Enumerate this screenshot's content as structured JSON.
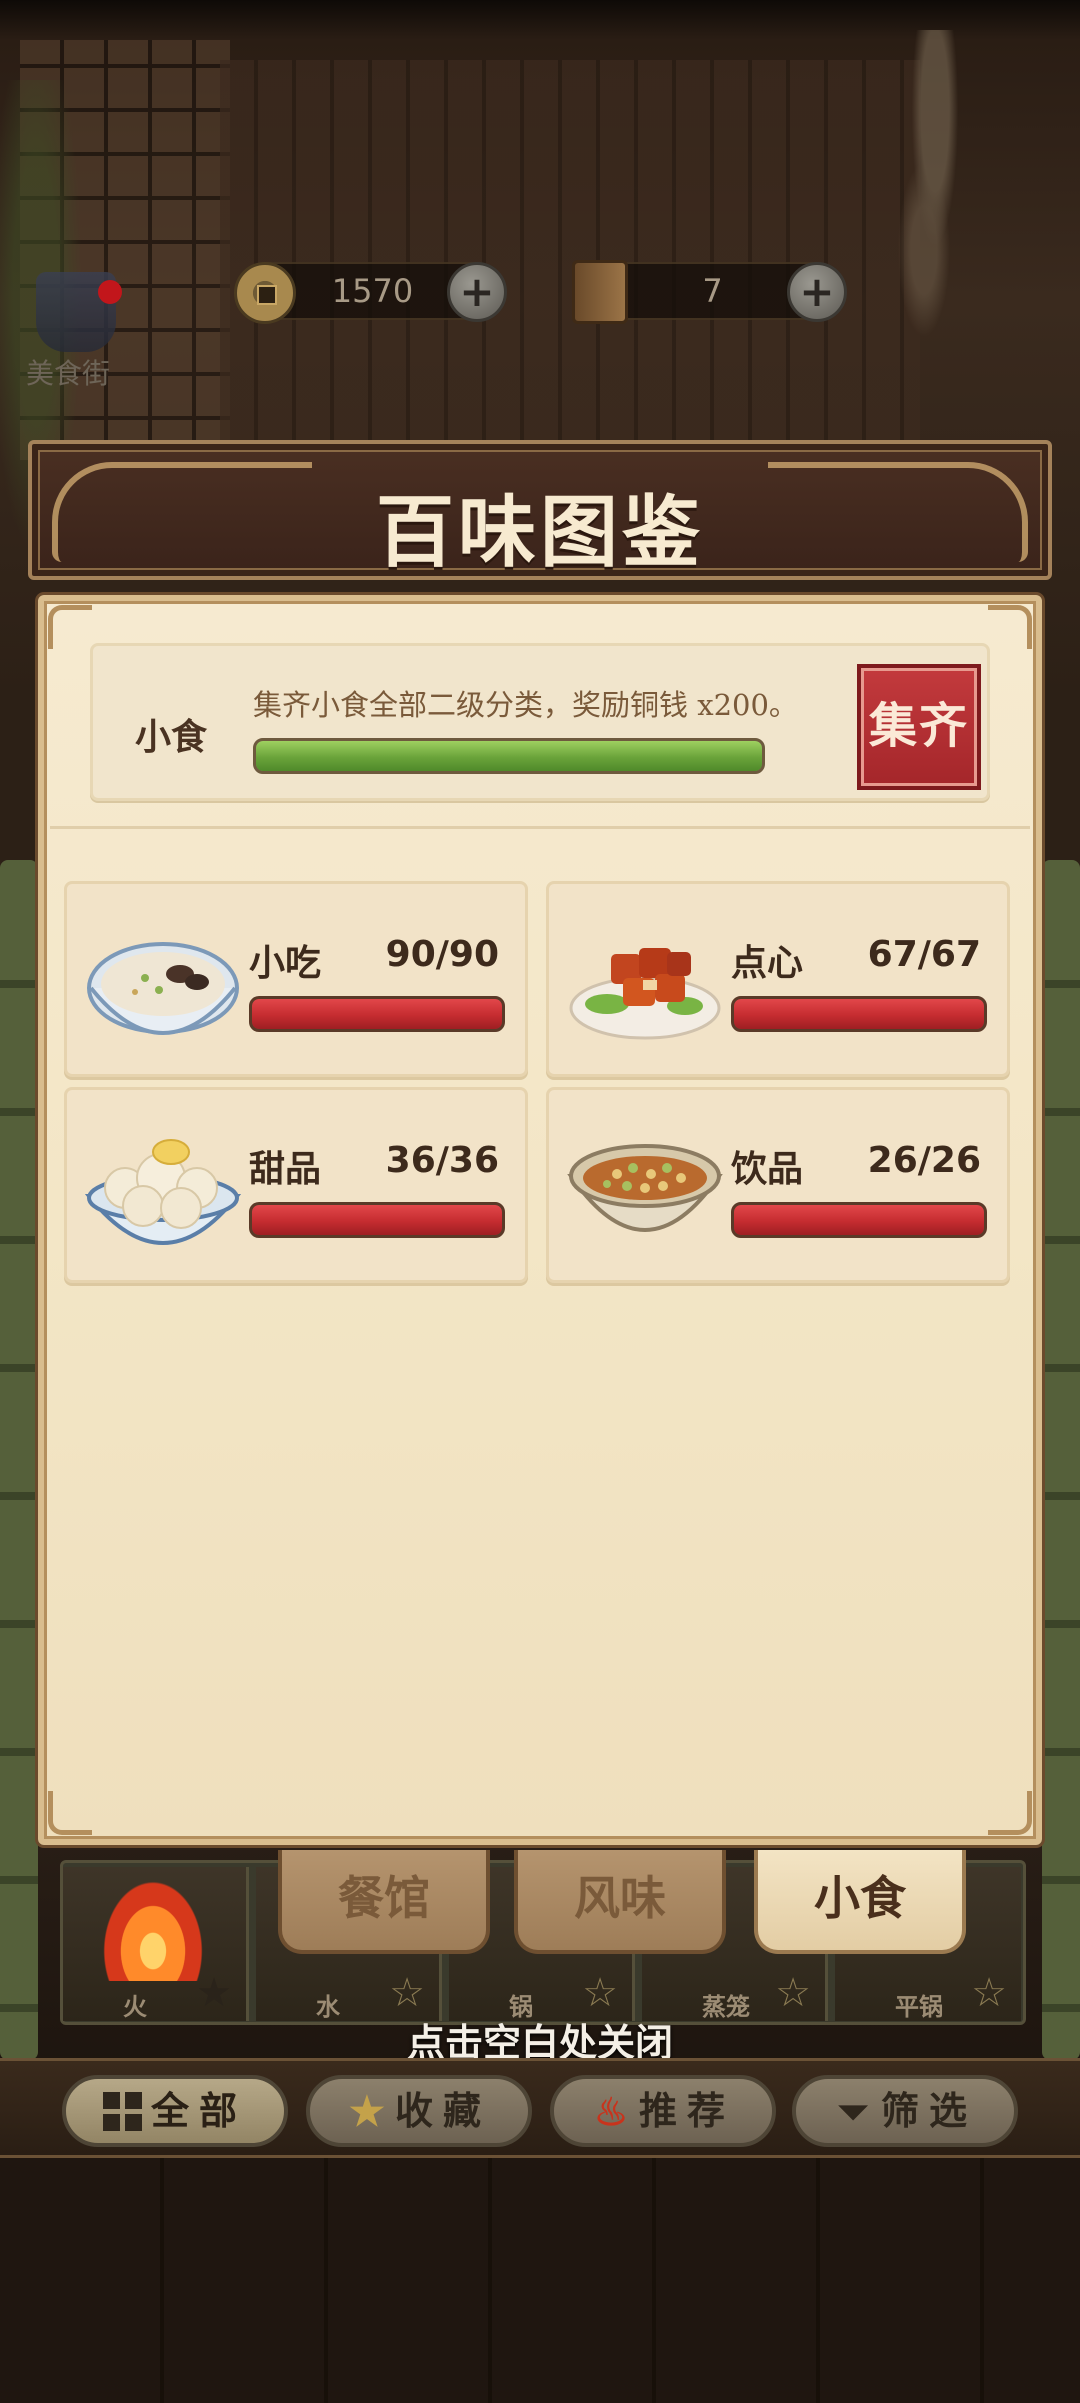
{
  "top_bar": {
    "street_label": "美食街",
    "coins": "1570",
    "books": "7",
    "plus_label": "+"
  },
  "title": "百味图鉴",
  "collect": {
    "category": "小食",
    "description": "集齐小食全部二级分类，奖励铜钱 x200。",
    "progress": 1.0,
    "button_label": "集齐",
    "progress_color": "#6aa33a"
  },
  "categories": [
    {
      "name": "小吃",
      "count": "90/90",
      "progress": 1.0,
      "dish_icon": "congee-bowl-icon"
    },
    {
      "name": "点心",
      "count": "67/67",
      "progress": 1.0,
      "dish_icon": "braised-pork-plate-icon"
    },
    {
      "name": "甜品",
      "count": "36/36",
      "progress": 1.0,
      "dish_icon": "dumplings-bowl-icon"
    },
    {
      "name": "饮品",
      "count": "26/26",
      "progress": 1.0,
      "dish_icon": "bean-soup-bowl-icon"
    }
  ],
  "type_tabs": [
    {
      "label": "餐馆",
      "active": false
    },
    {
      "label": "风味",
      "active": false
    },
    {
      "label": "小食",
      "active": true
    }
  ],
  "methods": [
    {
      "label": "火",
      "star_filled": false
    },
    {
      "label": "水",
      "star_filled": true
    },
    {
      "label": "锅",
      "star_filled": true
    },
    {
      "label": "蒸笼",
      "star_filled": true
    },
    {
      "label": "平锅",
      "star_filled": true
    }
  ],
  "close_hint": "点击空白处关闭",
  "filters": [
    {
      "label": "全部",
      "icon": "grid-icon",
      "active": true
    },
    {
      "label": "收藏",
      "icon": "star-icon",
      "active": false
    },
    {
      "label": "推荐",
      "icon": "flame-icon",
      "active": false
    },
    {
      "label": "筛选",
      "icon": "funnel-icon",
      "active": false
    }
  ],
  "colors": {
    "progress_red": "#c52c30",
    "collect_button": "#a4262a",
    "panel_bg": "#f3e6c6",
    "banner_bg": "#3a231a"
  }
}
